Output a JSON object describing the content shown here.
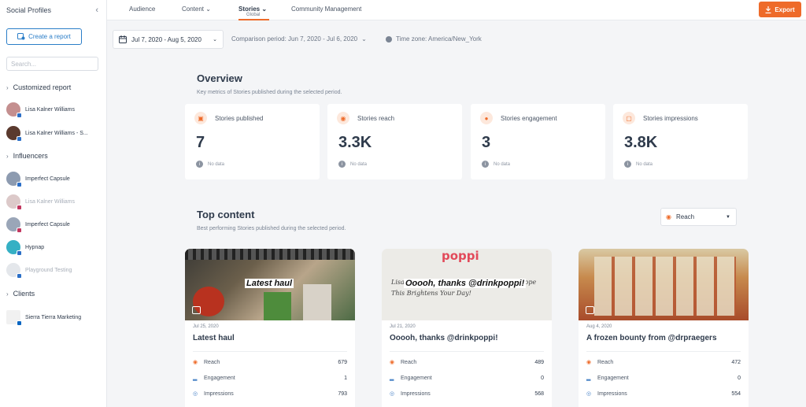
{
  "sidebar": {
    "title": "Social Profiles",
    "collapse_icon": "‹",
    "create_report": "Create a report",
    "search_placeholder": "Search...",
    "groups": [
      {
        "label": "Customized report"
      },
      {
        "label": "Influencers"
      },
      {
        "label": "Clients"
      }
    ],
    "profiles": [
      {
        "name": "Lisa Kalner Williams",
        "faded": false
      },
      {
        "name": "Lisa Kalner Williams - S...",
        "faded": false
      },
      {
        "name": "Imperfect Capsule",
        "faded": false
      },
      {
        "name": "Lisa Kalner Williams",
        "faded": true
      },
      {
        "name": "Imperfect Capsule",
        "faded": false
      },
      {
        "name": "Hypnap",
        "faded": false
      },
      {
        "name": "Playground Testing",
        "faded": true
      },
      {
        "name": "Sierra Tierra Marketing",
        "faded": false
      }
    ]
  },
  "nav": {
    "tabs": [
      "Audience",
      "Content",
      "Stories",
      "Community Management"
    ],
    "dropdown_marker": "⌄",
    "active_sub": "Global",
    "export": "Export"
  },
  "filters": {
    "date_range": "Jul 7, 2020 - Aug 5, 2020",
    "comparison": "Comparison period: Jun 7, 2020 - Jul 6, 2020",
    "timezone": "Time zone: America/New_York"
  },
  "overview": {
    "title": "Overview",
    "subtitle": "Key metrics of Stories published during the selected period.",
    "metrics": [
      {
        "label": "Stories published",
        "value": "7",
        "note": "No data"
      },
      {
        "label": "Stories reach",
        "value": "3.3K",
        "note": "No data"
      },
      {
        "label": "Stories engagement",
        "value": "3",
        "note": "No data"
      },
      {
        "label": "Stories impressions",
        "value": "3.8K",
        "note": "No data"
      }
    ]
  },
  "top_content": {
    "title": "Top content",
    "subtitle": "Best performing Stories published during the selected period.",
    "sort_value": "Reach",
    "row_labels": {
      "reach": "Reach",
      "engagement": "Engagement",
      "impressions": "Impressions"
    },
    "cards": [
      {
        "date": "Jul 25, 2020",
        "title": "Latest haul",
        "overlay": "Latest haul",
        "reach": "679",
        "engagement": "1",
        "impressions": "793"
      },
      {
        "date": "Jul 21, 2020",
        "title": "Ooooh, thanks @drinkpoppi!",
        "overlay": "Ooooh, thanks @drinkpoppi!",
        "brand": "poppi",
        "handwriting": "Lisa, We More Bubbles in your Life. We Hope This Brightens Your Day!",
        "reach": "489",
        "engagement": "0",
        "impressions": "568"
      },
      {
        "date": "Aug 4, 2020",
        "title": "A frozen bounty from @drpraegers",
        "reach": "472",
        "engagement": "0",
        "impressions": "554"
      }
    ]
  },
  "colors": {
    "accent": "#ee6b2a",
    "link": "#2b7ec8"
  }
}
